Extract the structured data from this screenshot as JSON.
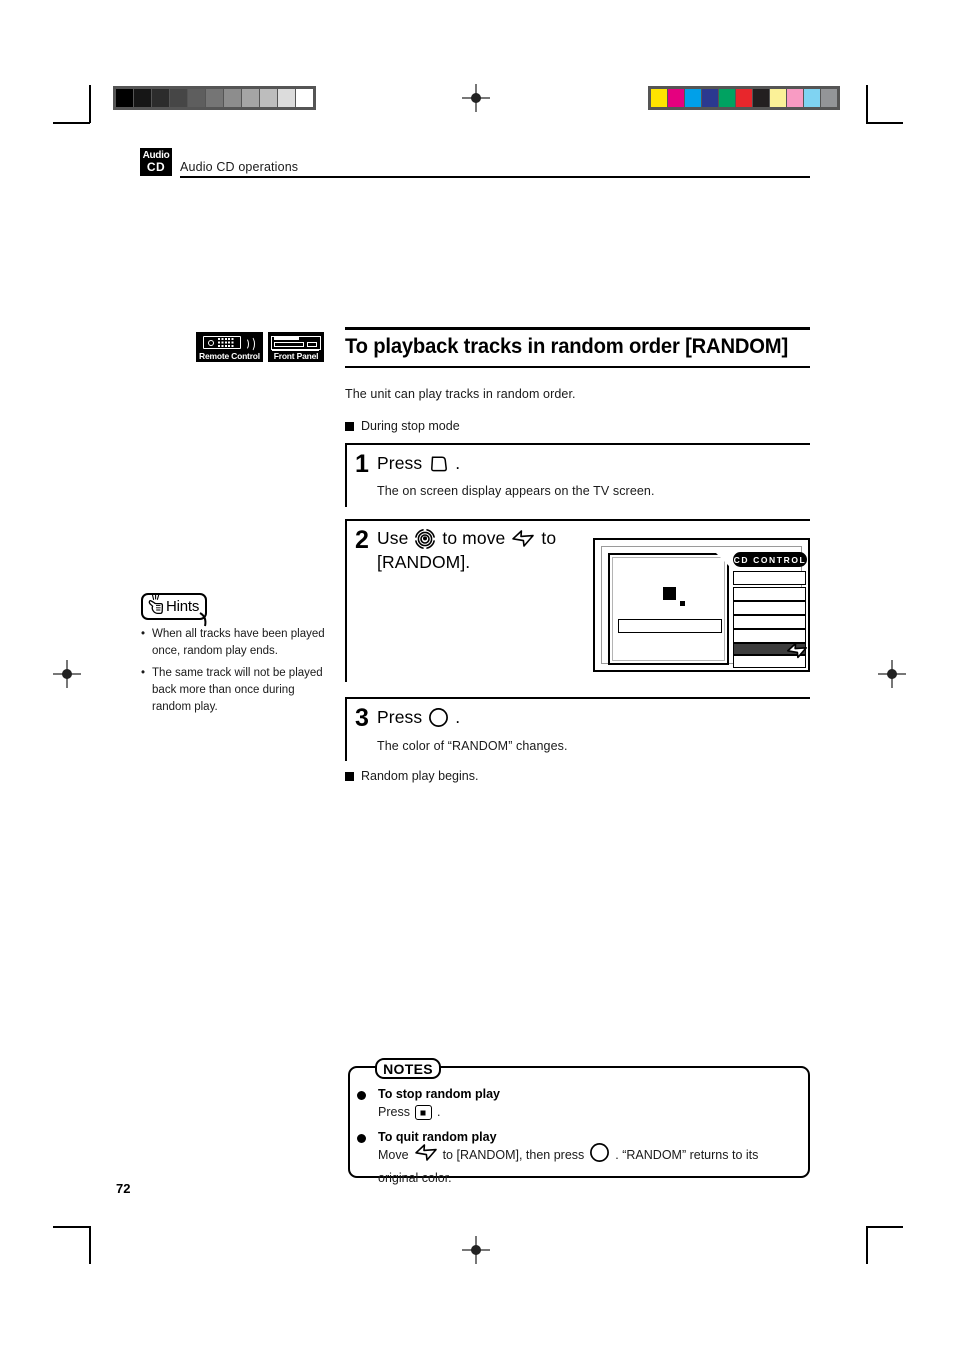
{
  "page": {
    "number": "72",
    "header_badge_line1": "Audio",
    "header_badge_line2": "CD",
    "header_title": "Audio CD operations"
  },
  "device_tags": [
    {
      "name": "remote-control-tag",
      "label": "Remote Control",
      "icon": "remote-control-icon"
    },
    {
      "name": "front-panel-tag",
      "label": "Front Panel",
      "icon": "front-panel-icon"
    }
  ],
  "section": {
    "title": "To playback tracks in random order [RANDOM]",
    "intro": "The unit can play tracks in random order.",
    "mode_heading": "During stop mode",
    "result_heading": "Random play begins."
  },
  "steps": [
    {
      "number": "1",
      "head_before": "Press",
      "icon": "osd-button-icon",
      "head_after": ".",
      "sub": "The on screen display appears on the TV screen."
    },
    {
      "number": "2",
      "head_before": "Use",
      "icon": "jog-dial-icon",
      "head_mid": "to move",
      "icon2": "cursor-arrow-icon",
      "head_after": "to",
      "head_line2": "[RANDOM].",
      "sub": ""
    },
    {
      "number": "3",
      "head_before": "Press",
      "icon": "enter-button-icon",
      "head_after": ".",
      "sub": "The color of “RANDOM” changes."
    }
  ],
  "osd": {
    "title_tab": "CD CONTROL",
    "menu_items": [
      "",
      "",
      "",
      "",
      "",
      "",
      ""
    ],
    "selected_index": 5
  },
  "hints": {
    "label": "Hints",
    "items": [
      "When all tracks have been played once, random play ends.",
      "The same track will not be played back more than once during random play."
    ],
    "bullet": "•"
  },
  "notes": {
    "tab_label": "NOTES",
    "entries": [
      {
        "title": "To stop random play",
        "line1_before": "Press",
        "icon": "stop-key-icon",
        "line1_after": "."
      },
      {
        "title": "To quit random play",
        "line1_before": "Move",
        "icon": "cursor-arrow-icon",
        "line1_mid": "to [RANDOM], then press",
        "icon2": "enter-button-icon",
        "line1_after": ".  “RANDOM” returns to its",
        "line2": "original color."
      }
    ]
  },
  "print_marks": {
    "gray_wedge": [
      "#000000",
      "#161616",
      "#2c2c2c",
      "#464646",
      "#5e5e5e",
      "#757575",
      "#8d8d8d",
      "#a5a5a5",
      "#bdbdbd",
      "#dcdcdc",
      "#ffffff"
    ],
    "color_bar": [
      "#ffe400",
      "#e5007f",
      "#00a0e9",
      "#2b3990",
      "#00a261",
      "#e8262c",
      "#231f20",
      "#fbf198",
      "#f89bc3",
      "#7fd3f2",
      "#939598"
    ]
  }
}
